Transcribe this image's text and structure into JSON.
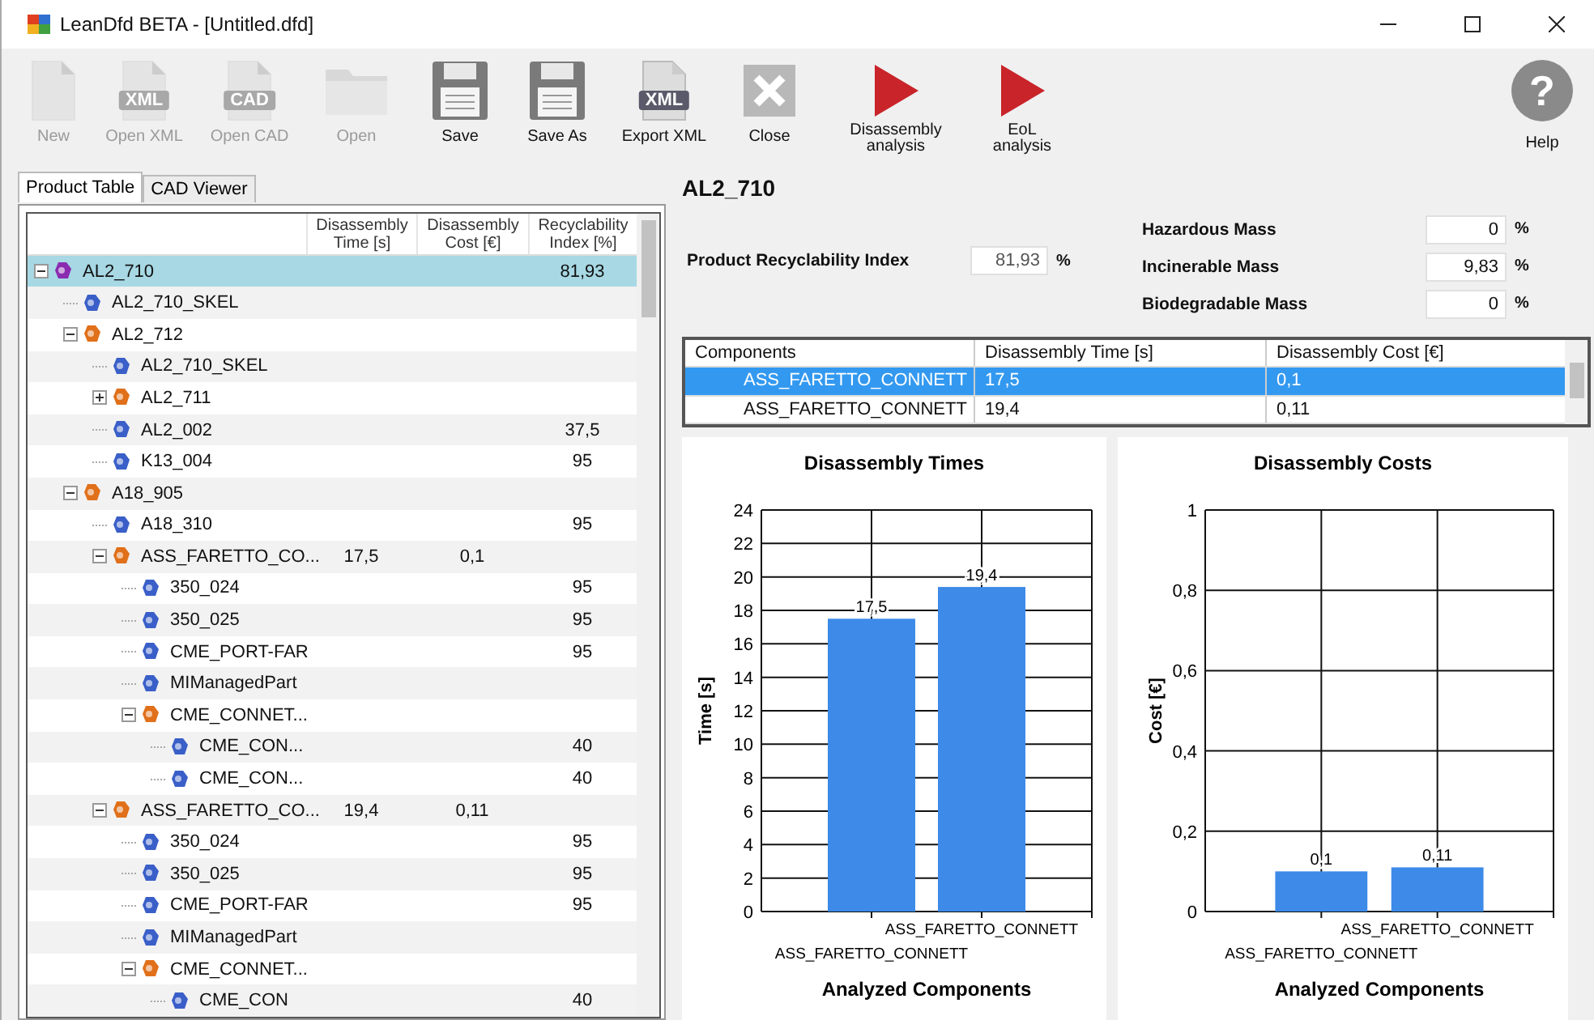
{
  "window": {
    "title": "LeanDfd BETA - [Untitled.dfd]"
  },
  "toolbar": [
    {
      "label": "New",
      "kind": "page",
      "disabled": true
    },
    {
      "label": "Open XML",
      "kind": "tagged-page",
      "badge": "XML",
      "disabled": true
    },
    {
      "label": "Open CAD",
      "kind": "tagged-page",
      "badge": "CAD",
      "disabled": true
    },
    {
      "label": "Open",
      "kind": "folder",
      "disabled": true
    },
    {
      "label": "Save",
      "kind": "floppy",
      "disabled": false
    },
    {
      "label": "Save As",
      "kind": "floppy",
      "disabled": false
    },
    {
      "label": "Export XML",
      "kind": "tagged-page",
      "badge": "XML",
      "disabled": false
    },
    {
      "label": "Close",
      "kind": "close",
      "disabled": false
    },
    {
      "label": "Disassembly analysis",
      "kind": "play",
      "disabled": false
    },
    {
      "label": "EoL analysis",
      "kind": "play",
      "disabled": false
    },
    {
      "label": "Help",
      "kind": "help",
      "badge": "?",
      "disabled": false
    }
  ],
  "tabs": [
    {
      "label": "Product Table",
      "selected": true
    },
    {
      "label": "CAD Viewer",
      "selected": false
    }
  ],
  "tree": {
    "columns": [
      "Disassembly Time [s]",
      "Disassembly Cost [€]",
      "Recyclability Index [%]"
    ],
    "items": [
      {
        "name": "AL2_710",
        "kind": "root",
        "expanded": true,
        "selected": true,
        "index": "81,93",
        "children": [
          {
            "name": "AL2_710_SKEL",
            "kind": "part",
            "selected": false
          },
          {
            "name": "AL2_712",
            "kind": "assembly",
            "expanded": true,
            "selected": false,
            "children": [
              {
                "name": "AL2_710_SKEL",
                "kind": "part",
                "selected": false
              },
              {
                "name": "AL2_711",
                "kind": "assembly",
                "expanded": false,
                "selected": false
              },
              {
                "name": "AL2_002",
                "kind": "part",
                "selected": false,
                "index": "37,5"
              },
              {
                "name": "K13_004",
                "kind": "part",
                "selected": false,
                "index": "95"
              }
            ]
          },
          {
            "name": "A18_905",
            "kind": "assembly",
            "expanded": true,
            "selected": false,
            "children": [
              {
                "name": "A18_310",
                "kind": "part",
                "selected": false,
                "index": "95"
              },
              {
                "name": "ASS_FARETTO_CO...",
                "kind": "assembly",
                "expanded": true,
                "selected": false,
                "time": "17,5",
                "cost": "0,1",
                "children": [
                  {
                    "name": "350_024",
                    "kind": "part",
                    "selected": false,
                    "index": "95"
                  },
                  {
                    "name": "350_025",
                    "kind": "part",
                    "selected": false,
                    "index": "95"
                  },
                  {
                    "name": "CME_PORT-FAR",
                    "kind": "part",
                    "selected": false,
                    "index": "95"
                  },
                  {
                    "name": "MIManagedPart",
                    "kind": "part",
                    "selected": false
                  },
                  {
                    "name": "CME_CONNET...",
                    "kind": "assembly",
                    "expanded": true,
                    "selected": false,
                    "children": [
                      {
                        "name": "CME_CON...",
                        "kind": "part",
                        "selected": false,
                        "index": "40"
                      },
                      {
                        "name": "CME_CON...",
                        "kind": "part",
                        "selected": false,
                        "index": "40"
                      }
                    ]
                  }
                ]
              },
              {
                "name": "ASS_FARETTO_CO...",
                "kind": "assembly",
                "expanded": true,
                "selected": false,
                "time": "19,4",
                "cost": "0,11",
                "children": [
                  {
                    "name": "350_024",
                    "kind": "part",
                    "selected": false,
                    "index": "95"
                  },
                  {
                    "name": "350_025",
                    "kind": "part",
                    "selected": false,
                    "index": "95"
                  },
                  {
                    "name": "CME_PORT-FAR",
                    "kind": "part",
                    "selected": false,
                    "index": "95"
                  },
                  {
                    "name": "MIManagedPart",
                    "kind": "part",
                    "selected": false
                  },
                  {
                    "name": "CME_CONNET...",
                    "kind": "assembly",
                    "expanded": true,
                    "selected": false,
                    "children": [
                      {
                        "name": "CME_CON",
                        "kind": "part",
                        "selected": false,
                        "index": "40"
                      }
                    ]
                  }
                ]
              }
            ]
          }
        ]
      }
    ]
  },
  "details": {
    "title": "AL2_710",
    "recyclability": {
      "label": "Product Recyclability Index",
      "value": "81,93",
      "unit": "%"
    },
    "masses": [
      {
        "label": "Hazardous Mass",
        "value": "0",
        "unit": "%"
      },
      {
        "label": "Incinerable Mass",
        "value": "9,83",
        "unit": "%"
      },
      {
        "label": "Biodegradable Mass",
        "value": "0",
        "unit": "%"
      }
    ],
    "grid": {
      "columns": [
        "Components",
        "Disassembly Time [s]",
        "Disassembly Cost [€]"
      ],
      "rows": [
        {
          "component": "ASS_FARETTO_CONNETT",
          "time": "17,5",
          "cost": "0,1",
          "selected": true
        },
        {
          "component": "ASS_FARETTO_CONNETT",
          "time": "19,4",
          "cost": "0,11",
          "selected": false
        }
      ]
    }
  },
  "charts": [
    {
      "chart_data": {
        "type": "bar",
        "title": "Disassembly Times",
        "xlabel": "Analyzed Components",
        "ylabel": "Time [s]",
        "categories": [
          "ASS_FARETTO_CONNETT",
          "ASS_FARETTO_CONNETT"
        ],
        "series": [
          {
            "color": "#3d8ae8",
            "values": [
              17.5,
              19.4
            ]
          }
        ],
        "ylim": [
          0,
          24
        ],
        "yticks": [
          0,
          2,
          4,
          6,
          8,
          10,
          12,
          14,
          16,
          18,
          20,
          22,
          24
        ],
        "grid": true,
        "value_labels": [
          "17,5",
          "19,4"
        ]
      }
    },
    {
      "chart_data": {
        "type": "bar",
        "title": "Disassembly Costs",
        "xlabel": "Analyzed Components",
        "ylabel": "Cost [€]",
        "categories": [
          "ASS_FARETTO_CONNETT",
          "ASS_FARETTO_CONNETT"
        ],
        "series": [
          {
            "color": "#3d8ae8",
            "values": [
              0.1,
              0.11
            ]
          }
        ],
        "ylim": [
          0,
          1
        ],
        "yticks": [
          0,
          {
            "value": 0.2,
            "label": "0,2"
          },
          {
            "value": 0.4,
            "label": "0,4"
          },
          {
            "value": 0.6,
            "label": "0,6"
          },
          {
            "value": 0.8,
            "label": "0,8"
          },
          1
        ],
        "grid": true,
        "value_labels": [
          "0,1",
          "0,11"
        ]
      }
    }
  ]
}
